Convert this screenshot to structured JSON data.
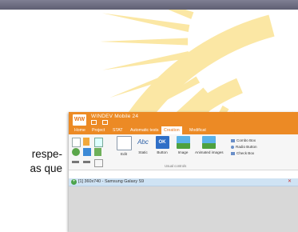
{
  "page_text": {
    "line1": "respe-",
    "line2": "as que"
  },
  "app": {
    "logo": "WW",
    "title": "WINDEV Mobile 24",
    "tabs": [
      "Home",
      "Project",
      "STAT",
      "Automatic tests",
      "Creation",
      "Modificat"
    ],
    "active_tab": "Creation",
    "ribbon": {
      "buttons": [
        "Edit",
        "Static",
        "Button",
        "Image",
        "Animated images"
      ],
      "static_icon_text": "Abc",
      "button_icon_text": "OK",
      "list_items": [
        "Combo Box",
        "Radio Button",
        "Check Box"
      ],
      "group_label": "Usual controls"
    },
    "document": {
      "title": "[1] 360x740 - Samsung Galaxy S9",
      "close_label": "✕"
    }
  },
  "colors": {
    "orange": "#ec8a25",
    "sun_yellow": "#fbe7a4",
    "sun_white_tri": "#ffffff",
    "doc_header": "#cfe3f4"
  },
  "icons": {
    "logo": "windev-logo-icon",
    "plus": "add-window-icon",
    "close": "close-icon"
  }
}
